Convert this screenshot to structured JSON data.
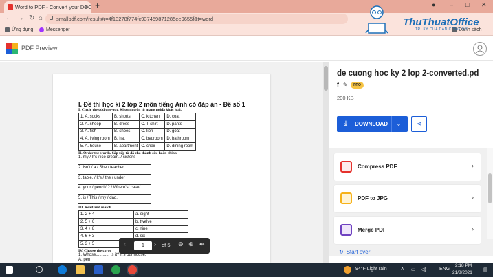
{
  "browser": {
    "tab_title": "Word to PDF - Convert your DOC",
    "tab_close": "×",
    "new_tab": "+",
    "url": "smallpdf.com/result#r=4f13278f774fc937459871285ee9655f&t=word",
    "window_controls": [
      "–",
      "□",
      "✕"
    ],
    "bookmarks": [
      {
        "label": "Ứng dụng",
        "icon": "apps-grid-icon"
      },
      {
        "label": "Messenger",
        "icon": "messenger-icon"
      }
    ],
    "reading_list": "Danh sách"
  },
  "watermark": {
    "brand": "ThuThuatOffice",
    "tagline": "TRI KỲ CỦA DÂN CÔNG SỞ"
  },
  "app": {
    "title": "PDF Preview",
    "user_icon": "user-icon"
  },
  "document": {
    "heading": "I. Đề thi học kì 2 lớp 2 môn tiếng Anh có đáp án - Đề số 1",
    "section1": "I. Circle the odd one-out. Khoanh tròn từ mang nghĩa khác loại.",
    "odd_one_out": [
      [
        "1. A. socks",
        "B. shorts",
        "C. kitchen",
        "D. coat"
      ],
      [
        "2. A. sheep",
        "B. dress",
        "C. T-shirt",
        "D. pants"
      ],
      [
        "3. A. fish",
        "B. shoes",
        "C. lion",
        "D. goat"
      ],
      [
        "4. A. living room",
        "B. hat",
        "C. bedroom",
        "D. bathroom"
      ],
      [
        "5. A. house",
        "B. apartment",
        "C. chair",
        "D. dining room"
      ]
    ],
    "section2": "II. Order the words. Sắp xếp từ đã cho thành câu hoàn chỉnh.",
    "order_words": [
      "1. my / It's / ice cream. / sister's",
      "2. isn't / a / She / teacher.",
      "3. table. / It's / the / under",
      "4. your / pencil/ ? / Where's/ case/",
      "5. is / This / my / dad."
    ],
    "section3": "III. Read and match.",
    "match": [
      [
        "1. 2 + 4",
        "a. eight"
      ],
      [
        "2. 5 + 6",
        "b. twelve"
      ],
      [
        "3. 4 + 8",
        "c. nine"
      ],
      [
        "4. 6 + 3",
        "d. six"
      ],
      [
        "5. 3 + 5",
        ""
      ]
    ],
    "section4": "IV. Choose the corre",
    "line_whose": "1. Whose............ is it? It's our house.",
    "line_pen": "A. pen"
  },
  "pager": {
    "prev": "‹",
    "current_page": "1",
    "next": "›",
    "of_total": "of 5"
  },
  "panel": {
    "file_name": "de cuong hoc ky 2 lop 2-converted.pd",
    "facebook": "f",
    "pro_badge": "PRO",
    "file_size": "200 KB",
    "download_label": "DOWNLOAD",
    "tools": [
      {
        "label": "Compress PDF",
        "icon": "compress-icon",
        "color": "#e5322d"
      },
      {
        "label": "PDF to JPG",
        "icon": "jpg-icon",
        "color": "#f6b21b"
      },
      {
        "label": "Merge PDF",
        "icon": "merge-icon",
        "color": "#6f42c1"
      }
    ],
    "start_over": "Start over"
  },
  "taskbar": {
    "weather": "94°F  Light rain",
    "language": "ENG",
    "time": "2:18 PM",
    "date": "21/8/2021"
  }
}
